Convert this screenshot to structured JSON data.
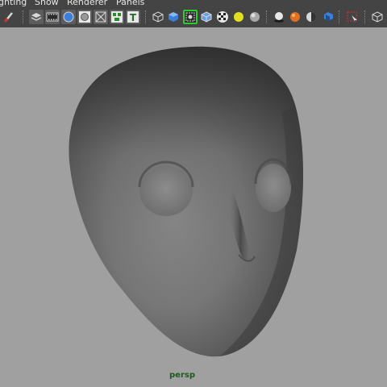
{
  "menubar": {
    "items": [
      "ghting",
      "Show",
      "Renderer",
      "Panels"
    ]
  },
  "toolbar": {
    "buttons": [
      {
        "icon": "paint-brush-icon"
      },
      {
        "icon": "select-layers-icon"
      },
      {
        "icon": "film-strip-icon"
      },
      {
        "icon": "camera-attributes-icon"
      },
      {
        "icon": "image-plane-icon"
      },
      {
        "icon": "grid-icon"
      },
      {
        "icon": "resolution-gate-icon"
      },
      {
        "icon": "text-icon",
        "glyph": "T"
      },
      {
        "icon": "wireframe-cube-icon"
      },
      {
        "icon": "smooth-shaded-cube-icon"
      },
      {
        "icon": "wireframe-on-shaded-icon"
      },
      {
        "icon": "textured-cube-icon"
      },
      {
        "icon": "checker-texture-icon"
      },
      {
        "icon": "default-light-icon"
      },
      {
        "icon": "sphere-shading-icon"
      },
      {
        "icon": "shadows-icon"
      },
      {
        "icon": "screen-space-ao-icon"
      },
      {
        "icon": "motion-blur-icon"
      },
      {
        "icon": "multisample-icon"
      },
      {
        "icon": "isolate-select-icon"
      },
      {
        "icon": "xray-cube-icon"
      }
    ],
    "colors": {
      "background": "#444444",
      "selected_outline": "#2ad12a",
      "blue": "#3b7fd8",
      "yellow": "#e0e020",
      "orange": "#e07020",
      "red": "#d83030"
    }
  },
  "viewport": {
    "camera_label": "persp",
    "background": "#a0a0a0",
    "label_color": "#1e5a1e"
  }
}
